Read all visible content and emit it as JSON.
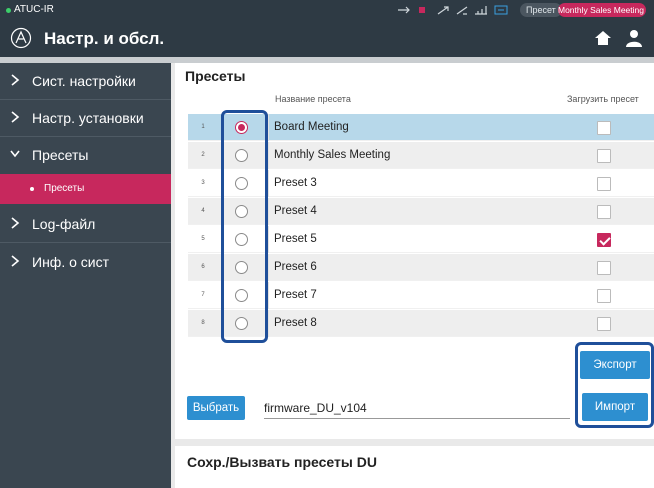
{
  "statusbar": {
    "app_name": "ATUC-IR",
    "preset_label": "Пресет",
    "current_preset": "Monthly Sales Meeting",
    "accent": "#c7285d"
  },
  "header": {
    "title": "Настр. и обсл.",
    "icons": [
      "audio-technica-logo",
      "home-icon",
      "user-icon"
    ]
  },
  "sidebar": {
    "items": [
      {
        "label": "Сист. настройки",
        "icon": "chevron-right-icon"
      },
      {
        "label": "Настр. установки",
        "icon": "chevron-right-icon"
      },
      {
        "label": "Пресеты",
        "icon": "chevron-down-icon"
      },
      {
        "label": "Log-файл",
        "icon": "chevron-right-icon"
      },
      {
        "label": "Инф. о сист",
        "icon": "chevron-right-icon"
      }
    ],
    "subitem": {
      "label": "Пресеты"
    }
  },
  "presets": {
    "title": "Пресеты",
    "col_name": "Название пресета",
    "col_load": "Загрузить пресет",
    "rows": [
      {
        "num": "1",
        "name": "Board Meeting",
        "selected": true,
        "load": false
      },
      {
        "num": "2",
        "name": "Monthly Sales Meeting",
        "selected": false,
        "load": false
      },
      {
        "num": "3",
        "name": "Preset 3",
        "selected": false,
        "load": false
      },
      {
        "num": "4",
        "name": "Preset 4",
        "selected": false,
        "load": false
      },
      {
        "num": "5",
        "name": "Preset 5",
        "selected": false,
        "load": true
      },
      {
        "num": "6",
        "name": "Preset 6",
        "selected": false,
        "load": false
      },
      {
        "num": "7",
        "name": "Preset 7",
        "selected": false,
        "load": false
      },
      {
        "num": "8",
        "name": "Preset 8",
        "selected": false,
        "load": false
      }
    ],
    "export_label": "Экспорт",
    "select_label": "Выбрать",
    "file_value": "firmware_DU_v104",
    "import_label": "Импорт"
  },
  "du_section": {
    "title": "Сохр./Вызвать пресеты DU"
  }
}
